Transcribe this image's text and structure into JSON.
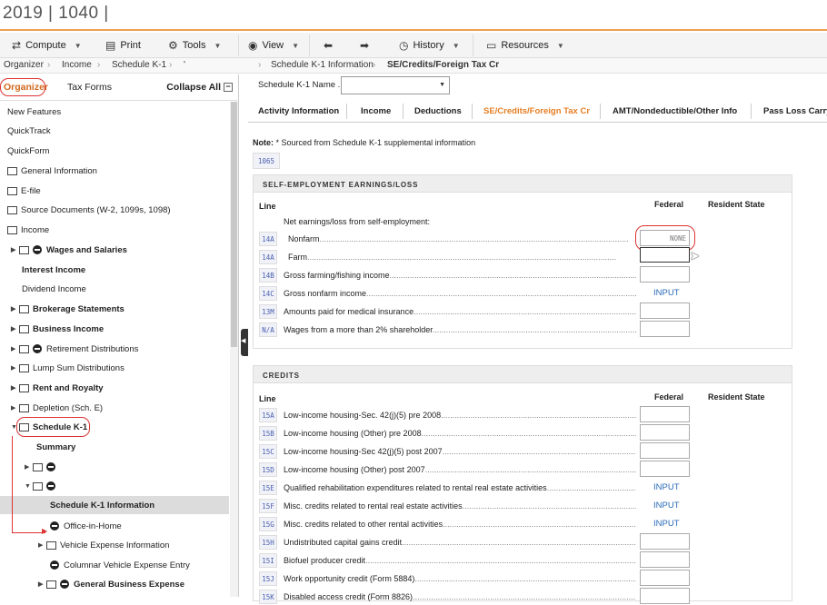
{
  "app": {
    "title": "2019 | 1040 |"
  },
  "toolbar": {
    "compute": "Compute",
    "print": "Print",
    "tools": "Tools",
    "view": "View",
    "history": "History",
    "resources": "Resources"
  },
  "breadcrumb": {
    "left": [
      "Organizer",
      "Income",
      "Schedule K-1",
      "'"
    ],
    "right": [
      "Schedule K-1 Information",
      "SE/Credits/Foreign Tax Cr"
    ]
  },
  "left_panel": {
    "tab_organizer": "Organizer",
    "tab_tax_forms": "Tax Forms",
    "collapse_all": "Collapse All",
    "collapse_glyph": "−",
    "items": [
      {
        "label": "New Features"
      },
      {
        "label": "QuickTrack"
      },
      {
        "label": "QuickForm"
      },
      {
        "label": "General Information"
      },
      {
        "label": "E-file"
      },
      {
        "label": "Source Documents (W-2, 1099s, 1098)"
      },
      {
        "label": "Income"
      },
      {
        "label": "Wages and Salaries"
      },
      {
        "label": "Interest Income"
      },
      {
        "label": "Dividend Income"
      },
      {
        "label": "Brokerage Statements"
      },
      {
        "label": "Business Income"
      },
      {
        "label": "Retirement Distributions"
      },
      {
        "label": "Lump Sum Distributions"
      },
      {
        "label": "Rent and Royalty"
      },
      {
        "label": "Depletion (Sch. E)"
      },
      {
        "label": "Schedule K-1"
      },
      {
        "label": "Summary"
      },
      {
        "label": ""
      },
      {
        "label": ""
      },
      {
        "label": "Schedule K-1 Information"
      },
      {
        "label": "Office-in-Home"
      },
      {
        "label": "Vehicle Expense Information"
      },
      {
        "label": "Columnar Vehicle Expense Entry"
      },
      {
        "label": "General Business Expense"
      }
    ]
  },
  "form": {
    "k1_name_label": "Schedule K-1 Name ...",
    "tabs": [
      "Activity Information",
      "Income",
      "Deductions",
      "SE/Credits/Foreign Tax Cr",
      "AMT/Nondeductible/Other Info",
      "Pass Loss Carryo"
    ],
    "note_prefix": "Note:",
    "note_text": " * Sourced from Schedule K-1 supplemental information",
    "form_code": "1065",
    "col_line": "Line",
    "col_federal": "Federal",
    "col_resident": "Resident State",
    "se_section": {
      "title": "SELF-EMPLOYMENT EARNINGS/LOSS",
      "subheading": "Net earnings/loss from self-employment:",
      "rows": [
        {
          "code": "14A",
          "label": "Nonfarm",
          "value": "NONE",
          "link": ""
        },
        {
          "code": "14A",
          "label": "Farm",
          "value": "",
          "link": ""
        },
        {
          "code": "14B",
          "label": "Gross farming/fishing income",
          "value": "",
          "link": ""
        },
        {
          "code": "14C",
          "label": "Gross nonfarm income",
          "value": "",
          "link": "INPUT"
        },
        {
          "code": "13M",
          "label": "Amounts paid for medical insurance",
          "value": "",
          "link": ""
        },
        {
          "code": "N/A",
          "label": "Wages from a more than 2% shareholder",
          "value": "",
          "link": ""
        }
      ]
    },
    "credits_section": {
      "title": "CREDITS",
      "rows": [
        {
          "code": "15A",
          "label": "Low-income housing-Sec. 42(j)(5) pre 2008",
          "value": "",
          "link": ""
        },
        {
          "code": "15B",
          "label": "Low-income housing (Other) pre 2008",
          "value": "",
          "link": ""
        },
        {
          "code": "15C",
          "label": "Low-income housing-Sec 42(j)(5) post 2007",
          "value": "",
          "link": ""
        },
        {
          "code": "15D",
          "label": "Low-income housing (Other) post 2007",
          "value": "",
          "link": ""
        },
        {
          "code": "15E",
          "label": "Qualified rehabilitation expenditures related to rental real estate activities",
          "value": "",
          "link": "INPUT"
        },
        {
          "code": "15F",
          "label": "Misc. credits related to rental real estate activities",
          "value": "",
          "link": "INPUT"
        },
        {
          "code": "15G",
          "label": "Misc. credits related to other rental activities",
          "value": "",
          "link": "INPUT"
        },
        {
          "code": "15H",
          "label": "Undistributed capital gains credit",
          "value": "",
          "link": ""
        },
        {
          "code": "15I",
          "label": "Biofuel producer credit",
          "value": "",
          "link": ""
        },
        {
          "code": "15J",
          "label": "Work opportunity credit (Form 5884)",
          "value": "",
          "link": ""
        },
        {
          "code": "15K",
          "label": "Disabled access credit (Form 8826)",
          "value": "",
          "link": ""
        }
      ]
    }
  }
}
